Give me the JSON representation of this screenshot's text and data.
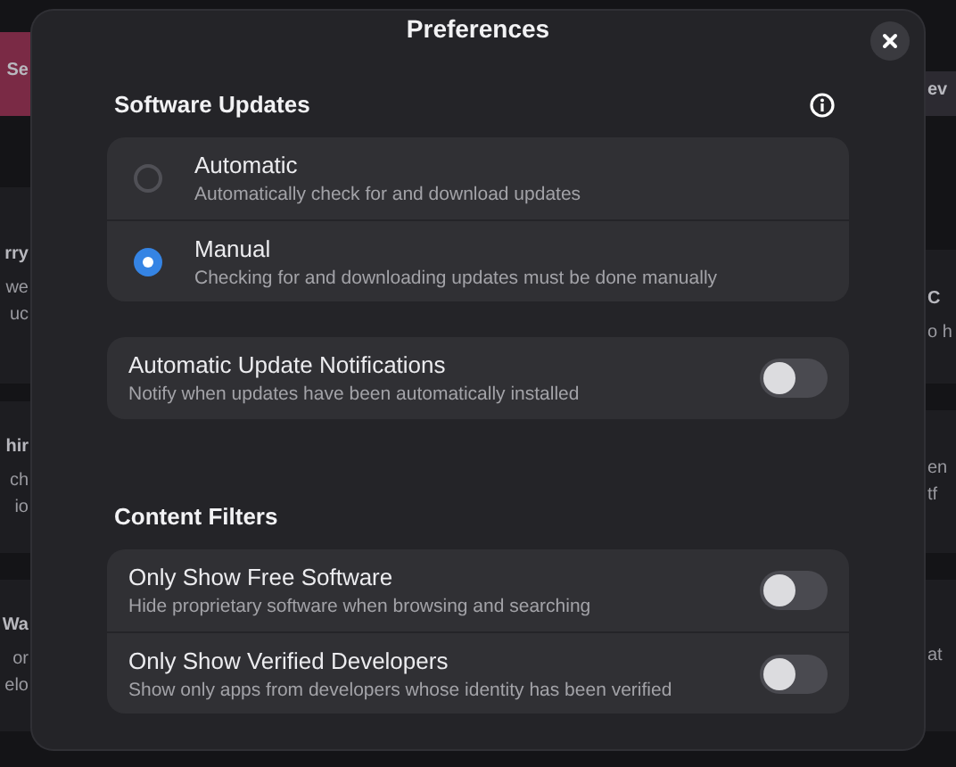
{
  "background": {
    "left_cards": [
      {
        "color": "#7a2a45",
        "lines": [
          {
            "text": "Se",
            "kind": "title"
          }
        ]
      },
      {
        "color": "#1d1d21",
        "lines": [
          {
            "text": "rry",
            "kind": "title"
          },
          {
            "text": "we",
            "kind": "text"
          },
          {
            "text": "uc",
            "kind": "text"
          }
        ]
      },
      {
        "color": "#1d1d21",
        "lines": [
          {
            "text": "hir",
            "kind": "title"
          },
          {
            "text": "ch",
            "kind": "text"
          },
          {
            "text": "io",
            "kind": "text"
          }
        ]
      },
      {
        "color": "#1d1d21",
        "lines": [
          {
            "text": "Wa",
            "kind": "title"
          },
          {
            "text": "or",
            "kind": "text"
          },
          {
            "text": "elo",
            "kind": "text"
          }
        ]
      }
    ],
    "right_cards": [
      {
        "color": "#2c2a31",
        "lines": [
          {
            "text": "ev",
            "kind": "title"
          }
        ]
      },
      {
        "color": "#1d1d21",
        "lines": [
          {
            "text": "C",
            "kind": "title"
          },
          {
            "text": "o h",
            "kind": "text"
          }
        ]
      },
      {
        "color": "#1d1d21",
        "lines": [
          {
            "text": "en",
            "kind": "text"
          },
          {
            "text": "tf",
            "kind": "text"
          }
        ]
      },
      {
        "color": "#1d1d21",
        "lines": [
          {
            "text": "at",
            "kind": "text"
          }
        ]
      }
    ]
  },
  "dialog": {
    "title": "Preferences",
    "sections": [
      {
        "title": "Software Updates",
        "has_info": true,
        "groups": [
          [
            {
              "kind": "radio",
              "title": "Automatic",
              "subtitle": "Automatically check for and download updates",
              "selected": false
            },
            {
              "kind": "radio",
              "title": "Manual",
              "subtitle": "Checking for and downloading updates must be done manually",
              "selected": true
            }
          ],
          [
            {
              "kind": "switch",
              "title": "Automatic Update Notifications",
              "subtitle": "Notify when updates have been automatically installed",
              "on": false
            }
          ]
        ]
      },
      {
        "title": "Content Filters",
        "has_info": false,
        "groups": [
          [
            {
              "kind": "switch",
              "title": "Only Show Free Software",
              "subtitle": "Hide proprietary software when browsing and searching",
              "on": false
            },
            {
              "kind": "switch",
              "title": "Only Show Verified Developers",
              "subtitle": "Show only apps from developers whose identity has been verified",
              "on": false
            }
          ]
        ]
      }
    ]
  }
}
